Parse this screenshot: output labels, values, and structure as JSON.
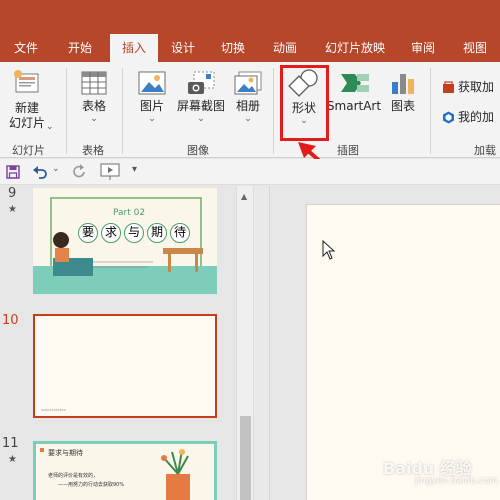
{
  "tabs": {
    "file": "文件",
    "home": "开始",
    "insert": "插入",
    "design": "设计",
    "transitions": "切换",
    "animations": "动画",
    "slideshow": "幻灯片放映",
    "review": "审阅",
    "view": "视图"
  },
  "ribbon": {
    "new_slide": "新建",
    "new_slide_2": "幻灯片",
    "table": "表格",
    "picture": "图片",
    "screenshot": "屏幕截图",
    "album": "相册",
    "shapes": "形状",
    "smartart": "SmartArt",
    "chart": "图表",
    "get_addins": "获取加",
    "my_addins": "我的加",
    "groups": {
      "slides": "幻灯片",
      "tables": "表格",
      "images": "图像",
      "illustrations": "插图",
      "addins": "加载"
    }
  },
  "slides": [
    {
      "num": "9",
      "part": "Part 02",
      "chars": [
        "要",
        "求",
        "与",
        "期",
        "待"
      ]
    },
    {
      "num": "10",
      "footer": "XXXXXXXXXXXX"
    },
    {
      "num": "11",
      "title": "要求与期待",
      "line1": "老师的评价是有效的，",
      "line2": "——用努力的行动去获取90%"
    }
  ],
  "watermark": {
    "brand": "Baidu 经验",
    "url": "jingyan.baidu.com"
  },
  "colors": {
    "accent": "#b7472a",
    "highlight": "#e41b1b",
    "active_tab_text": "#b7472a"
  }
}
